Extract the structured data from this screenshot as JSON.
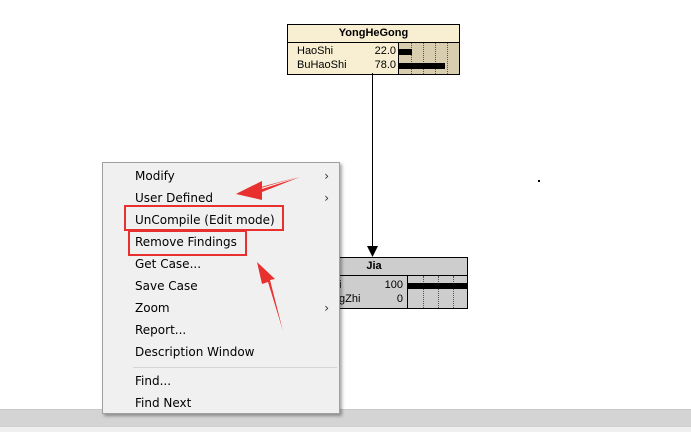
{
  "nodes": {
    "yonghegong": {
      "title": "YongHeGong",
      "states": [
        {
          "name": "HaoShi",
          "value": "22.0",
          "fraction": 0.22
        },
        {
          "name": "BuHaoShi",
          "value": "78.0",
          "fraction": 0.78
        }
      ]
    },
    "jia": {
      "title": "Jia",
      "states": [
        {
          "name": "i",
          "value": "100",
          "fraction": 1.0
        },
        {
          "name": "gZhi",
          "value": "0",
          "fraction": 0.0
        }
      ]
    }
  },
  "menu": {
    "items": [
      {
        "label": "Modify",
        "submenu": true
      },
      {
        "label": "User Defined",
        "submenu": true
      },
      {
        "label": "UnCompile (Edit mode)",
        "submenu": false
      },
      {
        "label": "Remove Findings",
        "submenu": false
      },
      {
        "label": "Get Case...",
        "submenu": false
      },
      {
        "label": "Save Case",
        "submenu": false
      },
      {
        "label": "Zoom",
        "submenu": true
      },
      {
        "label": "Report...",
        "submenu": false
      },
      {
        "label": "Description Window",
        "submenu": false
      },
      {
        "label": "Find...",
        "submenu": false
      },
      {
        "label": "Find Next",
        "submenu": false
      }
    ],
    "submenu_glyph": "›"
  },
  "annotation_color": "#e8312f"
}
